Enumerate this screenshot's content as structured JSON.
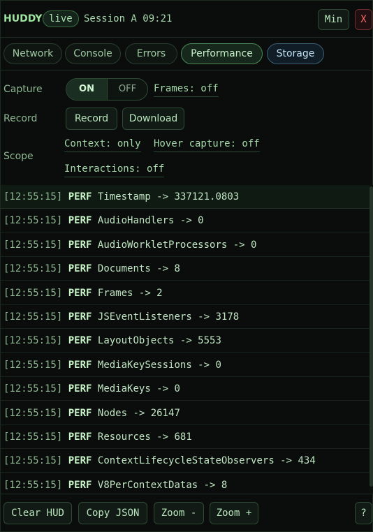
{
  "header": {
    "brand": "HUDDY",
    "status_badge": "live",
    "session_label": "Session A 09:21",
    "min_label": "Min",
    "close_label": "X"
  },
  "tabs": [
    {
      "label": "Network",
      "active": false
    },
    {
      "label": "Console",
      "active": false
    },
    {
      "label": "Errors",
      "active": false
    },
    {
      "label": "Performance",
      "active": true
    },
    {
      "label": "Storage",
      "active": false
    }
  ],
  "controls": {
    "capture_label": "Capture",
    "capture_on": "ON",
    "capture_off": "OFF",
    "frames_link": "Frames: off",
    "record_label": "Record",
    "record_button": "Record",
    "download_button": "Download",
    "scope_label": "Scope",
    "context_link": "Context: only",
    "hover_link": "Hover capture: off",
    "interactions_link": "Interactions: off"
  },
  "log": [
    {
      "time": "[12:55:15]",
      "level": "PERF",
      "message": "Timestamp -> 337121.0803"
    },
    {
      "time": "[12:55:15]",
      "level": "PERF",
      "message": "AudioHandlers -> 0"
    },
    {
      "time": "[12:55:15]",
      "level": "PERF",
      "message": "AudioWorkletProcessors -> 0"
    },
    {
      "time": "[12:55:15]",
      "level": "PERF",
      "message": "Documents -> 8"
    },
    {
      "time": "[12:55:15]",
      "level": "PERF",
      "message": "Frames -> 2"
    },
    {
      "time": "[12:55:15]",
      "level": "PERF",
      "message": "JSEventListeners -> 3178"
    },
    {
      "time": "[12:55:15]",
      "level": "PERF",
      "message": "LayoutObjects -> 5553"
    },
    {
      "time": "[12:55:15]",
      "level": "PERF",
      "message": "MediaKeySessions -> 0"
    },
    {
      "time": "[12:55:15]",
      "level": "PERF",
      "message": "MediaKeys -> 0"
    },
    {
      "time": "[12:55:15]",
      "level": "PERF",
      "message": "Nodes -> 26147"
    },
    {
      "time": "[12:55:15]",
      "level": "PERF",
      "message": "Resources -> 681"
    },
    {
      "time": "[12:55:15]",
      "level": "PERF",
      "message": "ContextLifecycleStateObservers -> 434"
    },
    {
      "time": "[12:55:15]",
      "level": "PERF",
      "message": "V8PerContextDatas -> 8"
    }
  ],
  "footer": {
    "clear_label": "Clear HUD",
    "copy_label": "Copy JSON",
    "zoom_out_label": "Zoom -",
    "zoom_in_label": "Zoom +",
    "help_label": "?"
  },
  "colors": {
    "accent": "#9ee59f",
    "close": "#ff6a6a",
    "storage": "#bfe0f2"
  }
}
